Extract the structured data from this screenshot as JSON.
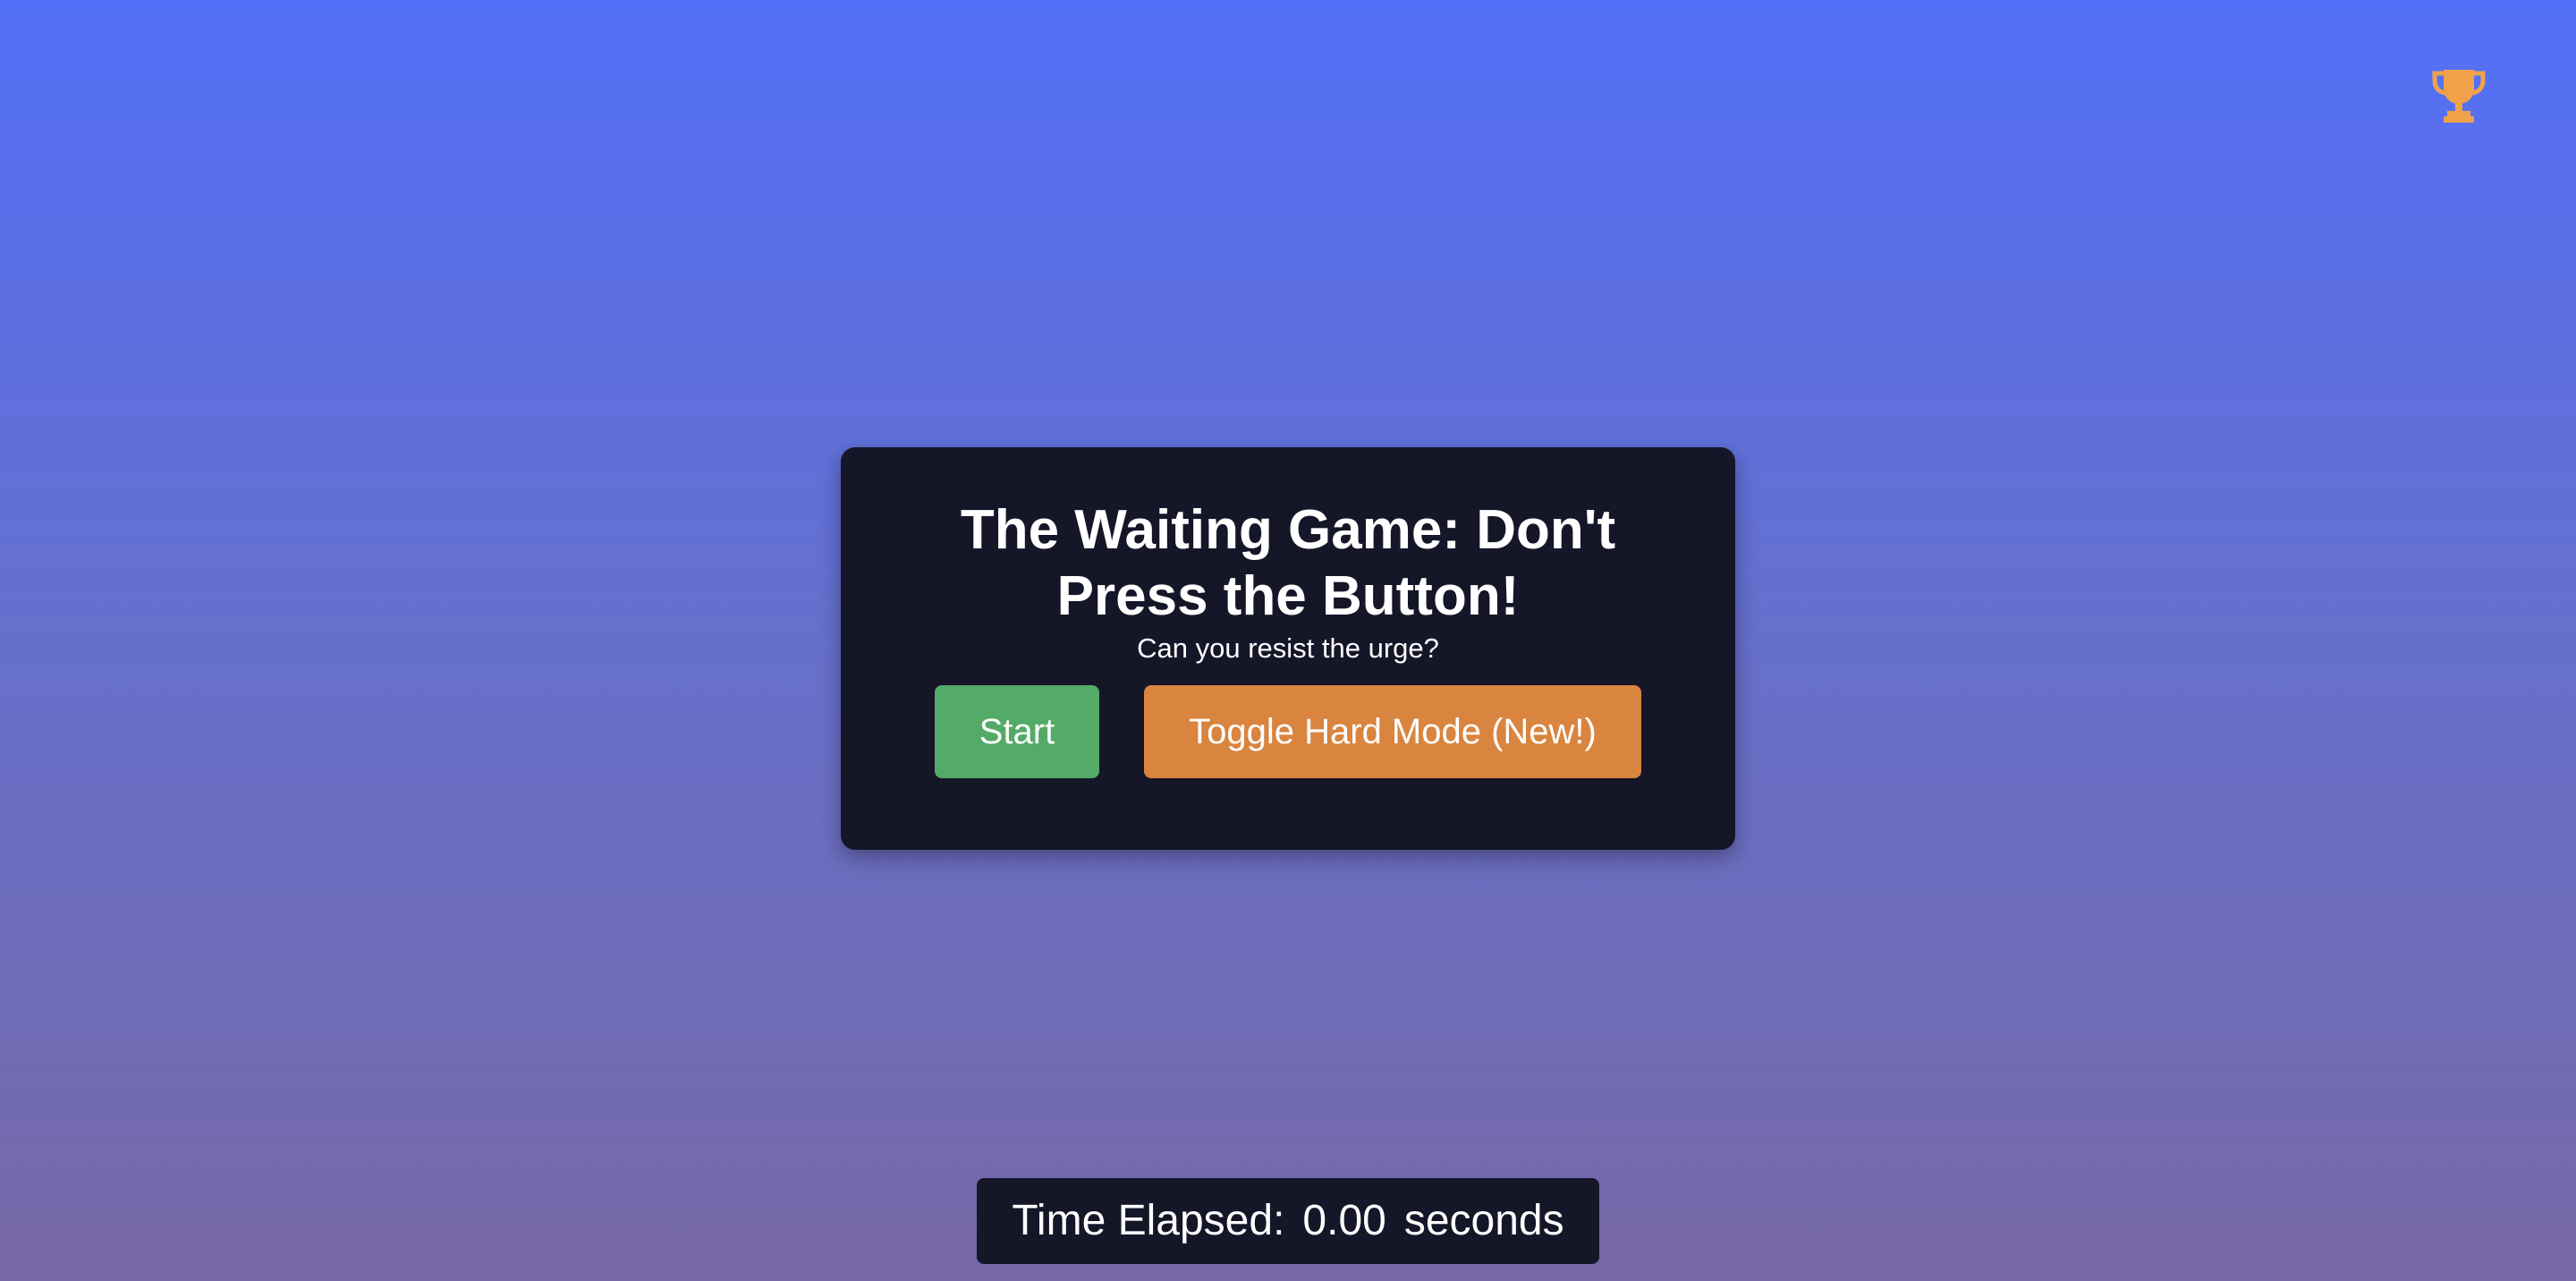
{
  "icons": {
    "trophy": "trophy-icon",
    "trophy_color": "#f0a24a"
  },
  "game": {
    "title_line1": "The Waiting Game: Don't",
    "title_line2": "Press the Button!",
    "subtitle": "Can you resist the urge?",
    "start_label": "Start",
    "hard_mode_label": "Toggle Hard Mode (New!)"
  },
  "timer": {
    "label": "Time Elapsed:",
    "value": "0.00",
    "unit": "seconds"
  },
  "colors": {
    "background_top": "#5470f8",
    "background_bottom": "#7768a6",
    "card": "#151628",
    "start_button": "#54aa67",
    "hard_mode_button": "#d9843f"
  }
}
